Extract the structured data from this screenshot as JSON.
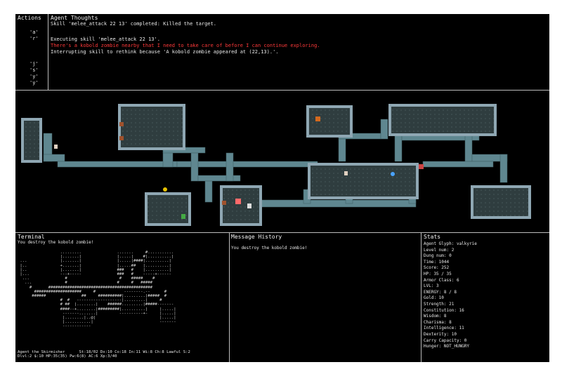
{
  "actions": {
    "header": "Actions",
    "keys": [
      "'a'",
      "'r'",
      "'j'",
      "'s'",
      "'y'",
      "'y'"
    ]
  },
  "thoughts": {
    "header": "Agent Thoughts",
    "lines": [
      {
        "text": "Skill 'melee_attack 22 13' completed: Killed the target.",
        "color": "normal"
      },
      {
        "text": "",
        "color": "normal"
      },
      {
        "text": "Executing skill 'melee_attack 22 13'.",
        "color": "normal"
      },
      {
        "text": "There's a kobold zombie nearby that I need to take care of before I can continue exploring.",
        "color": "red"
      },
      {
        "text": "Interrupting skill to rethink because 'A kobold zombie appeared at (22,13).'.",
        "color": "normal"
      }
    ]
  },
  "terminal": {
    "header": "Terminal",
    "message": "You destroy the kobold zombie!",
    "ascii": [
      "                  .........               .......     #........... ",
      "                  |.......|               |.....|    #|..........| ",
      " ...              |.......|               |.....|####|..........| ",
      " |..              +.......|               |.....##   |..........| ",
      " |..              |.......|               ###   #    |..........| ",
      " |...             ---+-----               ###   #    -----+------ ",
      "  ...               #                      #    #####    #       ",
      "   ...              #                     #     #   #####         ",
      "     #       ############################################         ",
      "       ####################     #            --------.--      #   ",
      "      ######               ##     ##########|.........|#####  #  ",
      "                  #  #   -------------------|.........|     #    ",
      "                  # ##  |........|    ######.........|#####-------",
      "                  ####--+........|#########|..........|     |.....| ",
      "                   -------.......|         ----------+-     |.....| ",
      "                   |........|..@|                           |.....| ",
      "                   |...........|                            ------- ",
      "                   ------------                                     "
    ],
    "status1": "Agent the Skirmisher      St:18/02 Dx:10 Co:18 In:11 Wi:8 Ch:8 Lawful S:2",
    "status2": "Dlvl:2 $:10 HP:35(35) Pw:6(8) AC:6 Xp:3/40"
  },
  "messages": {
    "header": "Message History",
    "lines": [
      "You destroy the kobold zombie!"
    ]
  },
  "stats": {
    "header": "Stats",
    "lines": [
      "Agent Glyph: valkyrie",
      "Level num: 2",
      "Dung num: 0",
      "Time: 1044",
      "Score: 252",
      "HP: 35 / 35",
      "Armor Class: 6",
      "LVL: 3",
      "ENERGY: 8 / 8",
      "Gold: 10",
      "Strength: 21",
      "Constitution: 16",
      "Wisdom: 8",
      "Charisma: 8",
      "Intelligence: 11",
      "Dexterity: 10",
      "Carry Capacity: 0",
      "Hunger: NOT_HUNGRY"
    ]
  },
  "colors": {
    "background": "#000000",
    "wall": "#8fa7b3",
    "floor": "#2f3d3f",
    "corridor": "#5f8790",
    "text": "#e8e8e8",
    "alert": "#ff3a3a"
  }
}
